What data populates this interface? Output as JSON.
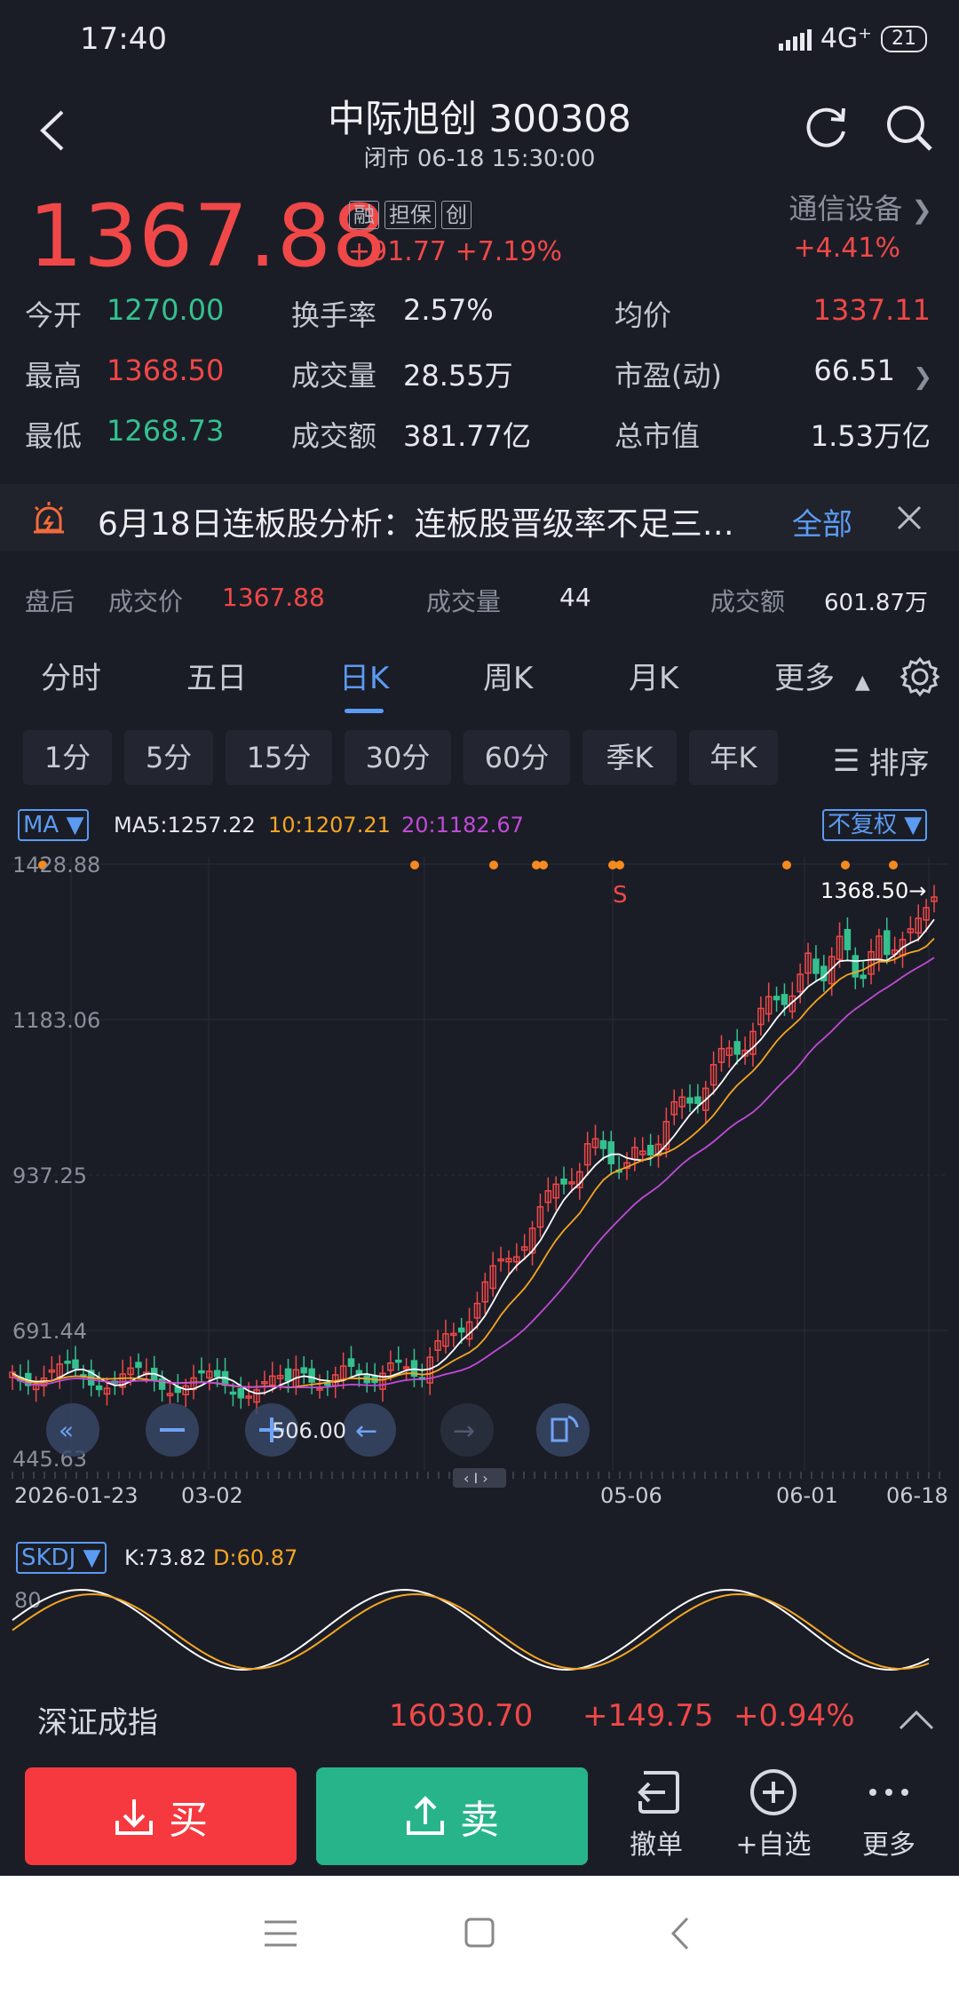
{
  "status_bar": {
    "time": "17:40",
    "network": "4G⁺",
    "battery": "21"
  },
  "header": {
    "title": "中际旭创 300308",
    "subtitle": "闭市 06-18 15:30:00"
  },
  "quote": {
    "price": "1367.88",
    "badges": [
      "融",
      "担保",
      "创"
    ],
    "change": "+91.77",
    "change_pct": "+7.19%",
    "sector": "通信设备",
    "sector_pct": "+4.41%",
    "rows": [
      {
        "l1": "今开",
        "v1": "1270.00",
        "l2": "换手率",
        "v2": "2.57%",
        "l3": "均价",
        "v3": "1337.11"
      },
      {
        "l1": "最高",
        "v1": "1368.50",
        "l2": "成交量",
        "v2": "28.55万",
        "l3": "市盈(动)",
        "v3": "66.51"
      },
      {
        "l1": "最低",
        "v1": "1268.73",
        "l2": "成交额",
        "v2": "381.77亿",
        "l3": "总市值",
        "v3": "1.53万亿"
      }
    ],
    "colors": {
      "up": "#f04848",
      "down": "#34c18f"
    }
  },
  "notice": {
    "text": "6月18日连板股分析：连板股晋级率不足三…",
    "all": "全部"
  },
  "after_hours": {
    "label": "盘后",
    "price_label": "成交价",
    "price": "1367.88",
    "vol_label": "成交量",
    "vol": "44",
    "amt_label": "成交额",
    "amt": "601.87万"
  },
  "tabs": [
    {
      "label": "分时"
    },
    {
      "label": "五日"
    },
    {
      "label": "日K"
    },
    {
      "label": "周K"
    },
    {
      "label": "月K"
    },
    {
      "label": "更多"
    }
  ],
  "active_tab": "日K",
  "intervals": [
    "1分",
    "5分",
    "15分",
    "30分",
    "60分",
    "季K",
    "年K"
  ],
  "sort_label": "排序",
  "chart": {
    "ma_selector": "MA",
    "ma5": "MA5:1257.22",
    "ma10": "10:1207.21",
    "ma20": "20:1182.67",
    "adjust": "不复权",
    "y_labels": [
      "1428.88",
      "1183.06",
      "937.25",
      "691.44",
      "445.63"
    ],
    "x_labels": [
      "2026-01-23",
      "03-02",
      "05-06",
      "06-01",
      "06-18"
    ],
    "high_label": "1368.50→",
    "low_label": "506.00",
    "signal_label": "S",
    "colors": {
      "ma5": "#ffffff",
      "ma10": "#f5a623",
      "ma20": "#c04bd8",
      "up": "#f04848",
      "down": "#34c18f"
    }
  },
  "indicator": {
    "name": "SKDJ",
    "k": "K:73.82",
    "d": "D:60.87",
    "level": "80"
  },
  "index_bar": {
    "name": "深证成指",
    "value": "16030.70",
    "change": "+149.75",
    "pct": "+0.94%"
  },
  "actions": {
    "buy": "买",
    "sell": "卖",
    "cancel": "撤单",
    "watch": "+自选",
    "more": "更多"
  }
}
